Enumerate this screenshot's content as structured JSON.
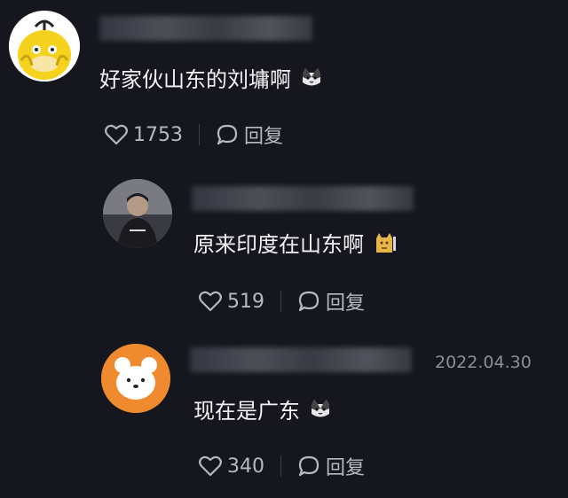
{
  "comments": [
    {
      "text": "好家伙山东的刘墉啊",
      "emoji": "cat-emoji",
      "like_count": "1753",
      "reply_label": "回复"
    },
    {
      "text": "原来印度在山东啊",
      "emoji": "sweat-doge-emoji",
      "like_count": "519",
      "reply_label": "回复"
    },
    {
      "text": "现在是广东",
      "emoji": "cat-emoji",
      "like_count": "340",
      "reply_label": "回复",
      "timestamp": "2022.04.30"
    }
  ],
  "colors": {
    "background": "#16161e",
    "text": "#f2f2f5",
    "secondary_text": "#b8b8c0",
    "bear_avatar": "#f08a2e",
    "duck_avatar": "#f5d21e"
  }
}
